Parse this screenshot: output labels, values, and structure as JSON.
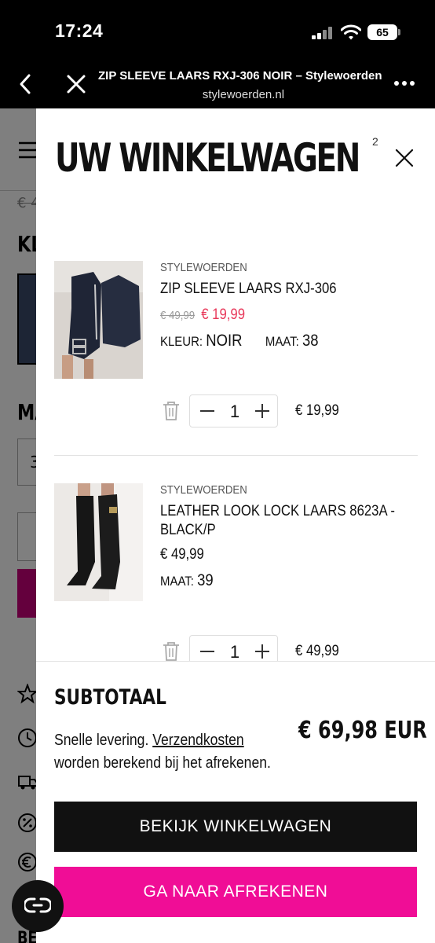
{
  "status_bar": {
    "time": "17:24",
    "battery": "65"
  },
  "browser": {
    "title": "ZIP SLEEVE LAARS RXJ-306 NOIR – Stylewoerden",
    "domain": "stylewoerden.nl"
  },
  "background_page": {
    "old_price_fragment": "€ 4",
    "label_kl": "KL",
    "label_ma": "MA",
    "size_fragment": "3",
    "bottom_fragment": "BE"
  },
  "cart": {
    "title": "UW WINKELWAGEN",
    "count": "2",
    "items": [
      {
        "vendor": "STYLEWOERDEN",
        "name": "ZIP SLEEVE LAARS RXJ-306",
        "old_price": "€ 49,99",
        "price": "€ 19,99",
        "color_label": "KLEUR:",
        "color_value": "NOIR",
        "size_label": "MAAT:",
        "size_value": "38",
        "quantity": "1",
        "line_total": "€ 19,99"
      },
      {
        "vendor": "STYLEWOERDEN",
        "name": "LEATHER LOOK LOCK LAARS 8623A - BLACK/P",
        "price": "€ 49,99",
        "size_label": "MAAT:",
        "size_value": "39",
        "quantity": "1",
        "line_total": "€ 49,99"
      }
    ],
    "subtotal_label": "SUBTOTAAL",
    "subtotal_value": "€ 69,98 EUR",
    "shipping_note_prefix": "Snelle levering.",
    "shipping_link": "Verzendkosten",
    "shipping_note_suffix": "worden berekend bij het afrekenen.",
    "view_cart_button": "BEKIJK WINKELWAGEN",
    "checkout_button": "GA NAAR AFREKENEN"
  },
  "colors": {
    "accent": "#f00d96",
    "sale": "#e8385a",
    "dark": "#111111"
  },
  "icons": [
    "back-icon",
    "close-icon",
    "more-icon",
    "trash-icon",
    "minus-icon",
    "plus-icon",
    "chat-icon",
    "menu-icon",
    "star-icon",
    "clock-icon",
    "truck-icon",
    "percent-icon",
    "euro-icon"
  ]
}
